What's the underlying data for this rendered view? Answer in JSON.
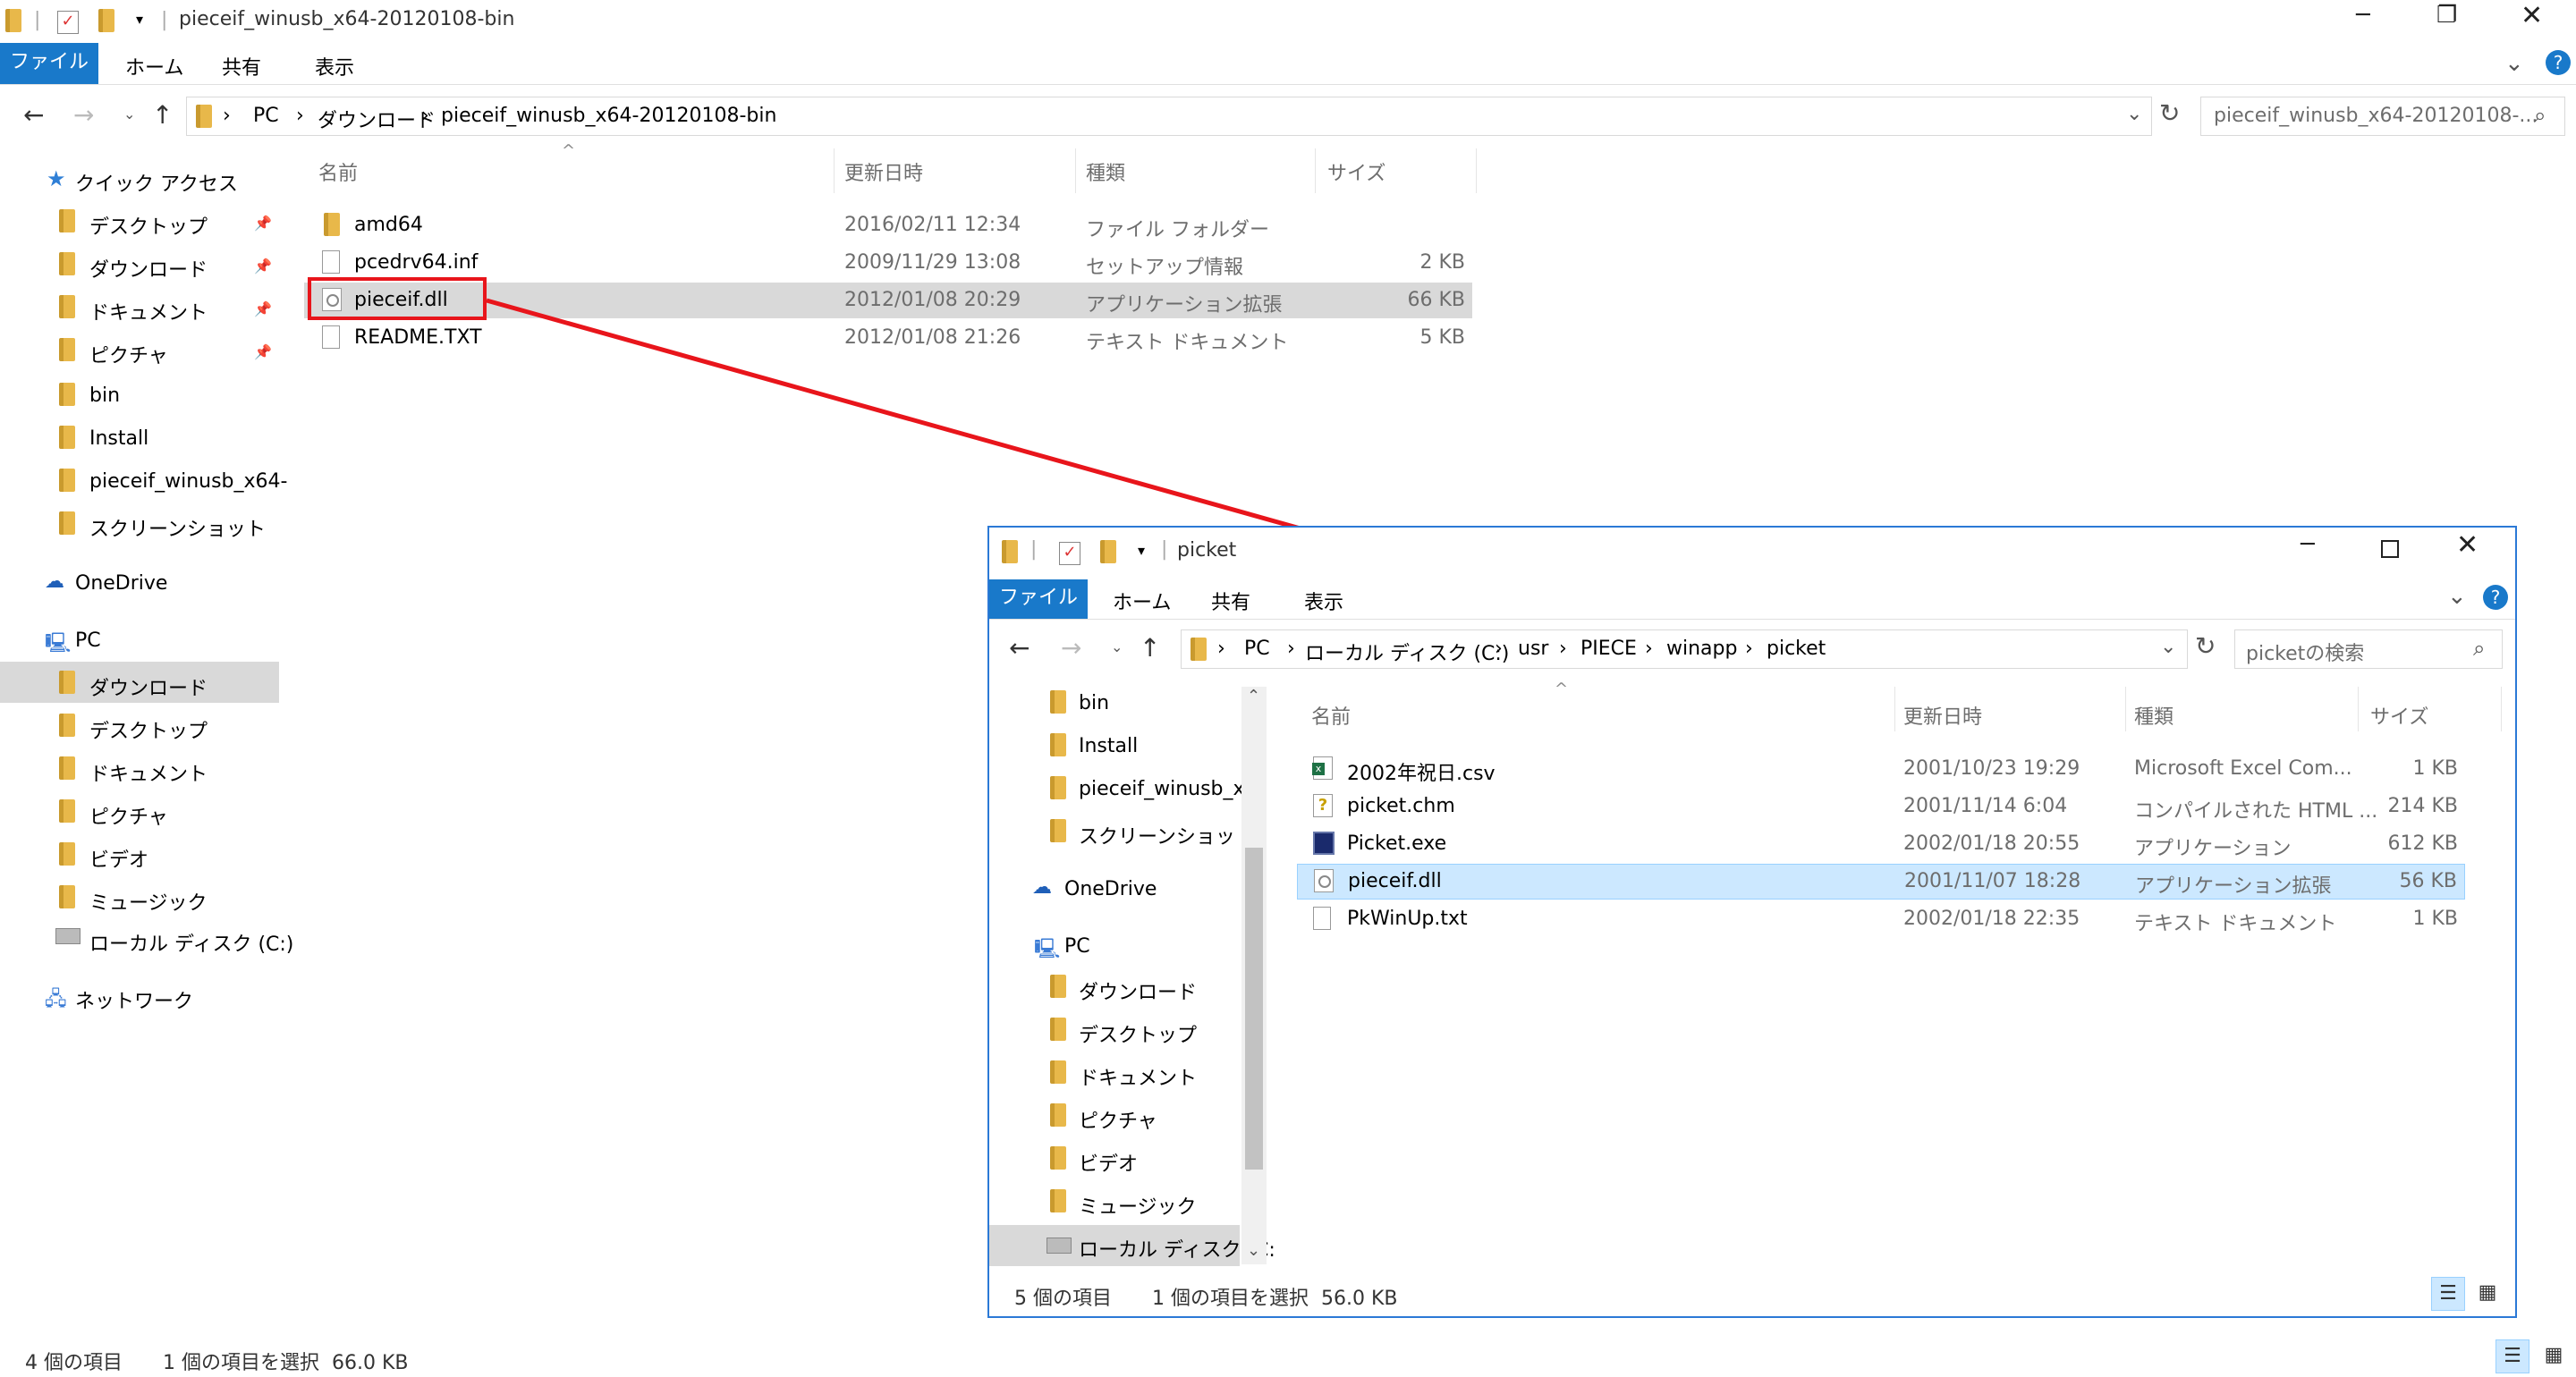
{
  "main": {
    "title": "pieceif_winusb_x64-20120108-bin",
    "ribbon_tabs": [
      "ファイル",
      "ホーム",
      "共有",
      "表示"
    ],
    "breadcrumb": [
      "PC",
      "ダウンロード",
      "pieceif_winusb_x64-20120108-bin"
    ],
    "search_placeholder": "pieceif_winusb_x64-20120108-...",
    "columns": [
      "名前",
      "更新日時",
      "種類",
      "サイズ"
    ],
    "files": [
      {
        "name": "amd64",
        "date": "2016/02/11 12:34",
        "type": "ファイル フォルダー",
        "size": "",
        "icon": "folder-icon"
      },
      {
        "name": "pcedrv64.inf",
        "date": "2009/11/29 13:08",
        "type": "セットアップ情報",
        "size": "2 KB",
        "icon": "inf-file-icon"
      },
      {
        "name": "pieceif.dll",
        "date": "2012/01/08 20:29",
        "type": "アプリケーション拡張",
        "size": "66 KB",
        "icon": "dll-file-icon"
      },
      {
        "name": "README.TXT",
        "date": "2012/01/08 21:26",
        "type": "テキスト ドキュメント",
        "size": "5 KB",
        "icon": "text-file-icon"
      }
    ],
    "nav": {
      "quick_access": "クイック アクセス",
      "quick_items": [
        "デスクトップ",
        "ダウンロード",
        "ドキュメント",
        "ピクチャ",
        "bin",
        "Install",
        "pieceif_winusb_x64-",
        "スクリーンショット"
      ],
      "onedrive": "OneDrive",
      "pc": "PC",
      "pc_items": [
        "ダウンロード",
        "デスクトップ",
        "ドキュメント",
        "ピクチャ",
        "ビデオ",
        "ミュージック",
        "ローカル ディスク (C:)"
      ],
      "network": "ネットワーク"
    },
    "status_count": "4 個の項目",
    "status_selected": "1 個の項目を選択  66.0 KB"
  },
  "picket": {
    "title": "picket",
    "ribbon_tabs": [
      "ファイル",
      "ホーム",
      "共有",
      "表示"
    ],
    "breadcrumb": [
      "PC",
      "ローカル ディスク (C:)",
      "usr",
      "PIECE",
      "winapp",
      "picket"
    ],
    "search_placeholder": "picketの検索",
    "columns": [
      "名前",
      "更新日時",
      "種類",
      "サイズ"
    ],
    "files": [
      {
        "name": "2002年祝日.csv",
        "date": "2001/10/23 19:29",
        "type": "Microsoft Excel Com...",
        "size": "1 KB",
        "icon": "excel-file-icon"
      },
      {
        "name": "picket.chm",
        "date": "2001/11/14 6:04",
        "type": "コンパイルされた HTML ...",
        "size": "214 KB",
        "icon": "chm-file-icon"
      },
      {
        "name": "Picket.exe",
        "date": "2002/01/18 20:55",
        "type": "アプリケーション",
        "size": "612 KB",
        "icon": "exe-file-icon"
      },
      {
        "name": "pieceif.dll",
        "date": "2001/11/07 18:28",
        "type": "アプリケーション拡張",
        "size": "56 KB",
        "icon": "dll-file-icon"
      },
      {
        "name": "PkWinUp.txt",
        "date": "2002/01/18 22:35",
        "type": "テキスト ドキュメント",
        "size": "1 KB",
        "icon": "text-file-icon"
      }
    ],
    "nav": {
      "quick_items": [
        "bin",
        "Install",
        "pieceif_winusb_x",
        "スクリーンショット"
      ],
      "onedrive": "OneDrive",
      "pc": "PC",
      "pc_items": [
        "ダウンロード",
        "デスクトップ",
        "ドキュメント",
        "ピクチャ",
        "ビデオ",
        "ミュージック",
        "ローカル ディスク (C:"
      ]
    },
    "status_count": "5 個の項目",
    "status_selected": "1 個の項目を選択  56.0 KB"
  },
  "colors": {
    "accent": "#1979ca",
    "annotation": "#e8151b",
    "selected": "#cce8ff",
    "selected_gray": "#d9d9d9"
  }
}
